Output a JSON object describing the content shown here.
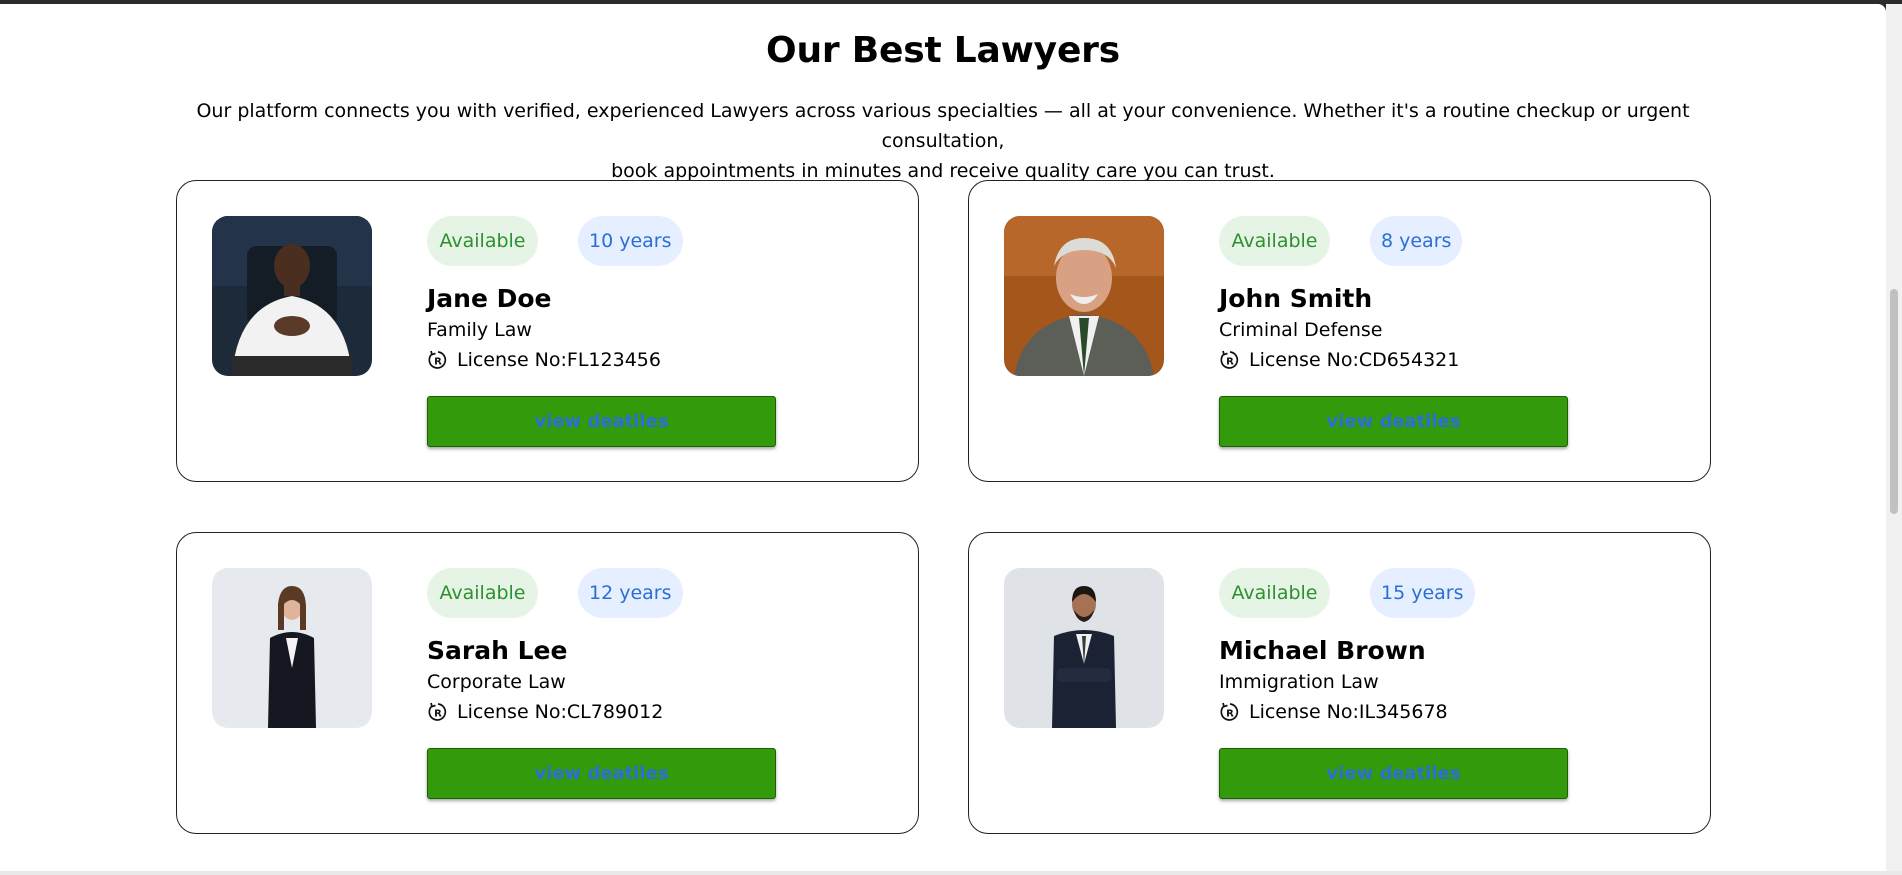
{
  "section": {
    "title": "Our Best Lawyers",
    "intro_line1": "Our platform connects you with verified, experienced Lawyers across various specialties — all at your convenience. Whether it's a routine checkup or urgent consultation,",
    "intro_line2": "book appointments in minutes and receive quality care you can trust."
  },
  "lawyers": [
    {
      "status": "Available",
      "experience": "10 years",
      "name": "Jane Doe",
      "specialty": "Family Law",
      "license": "License No:FL123456",
      "button_label": "view deatiles"
    },
    {
      "status": "Available",
      "experience": "8 years",
      "name": "John Smith",
      "specialty": "Criminal Defense",
      "license": "License No:CD654321",
      "button_label": "view deatiles"
    },
    {
      "status": "Available",
      "experience": "12 years",
      "name": "Sarah Lee",
      "specialty": "Corporate Law",
      "license": "License No:CL789012",
      "button_label": "view deatiles"
    },
    {
      "status": "Available",
      "experience": "15 years",
      "name": "Michael Brown",
      "specialty": "Immigration Law",
      "license": "License No:IL345678",
      "button_label": "view deatiles"
    }
  ],
  "colors": {
    "button_bg": "#339a0c",
    "button_text": "#2a6fd6",
    "status_bg": "#e6f4e6",
    "status_text": "#2f8f2f",
    "years_bg": "#e6efff",
    "years_text": "#2a6fd6"
  },
  "icons": {
    "license": "registered-icon"
  }
}
